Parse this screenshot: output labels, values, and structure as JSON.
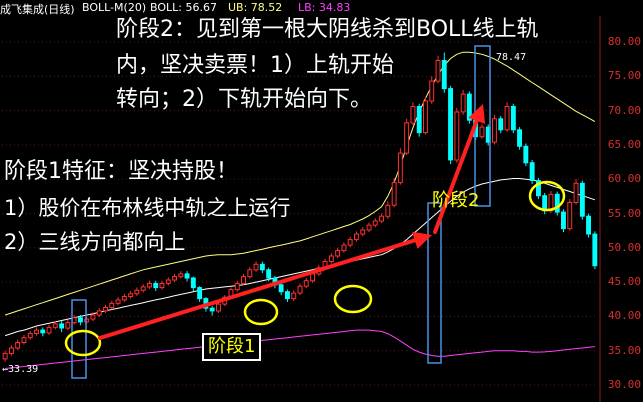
{
  "header": {
    "title": "成飞集成(日线)",
    "indicator": "BOLL-M(20)",
    "boll_label": "BOLL: 56.67",
    "ub_label": "UB: 78.52",
    "lb_label": "LB: 34.83"
  },
  "annotations": {
    "stage2_line1": "阶段2：见到第一根大阴线杀到BOLL线上轨",
    "stage2_line2": "内，坚决卖票！1）上轨开始",
    "stage2_line3": "转向；2）下轨开始向下。",
    "stage1_line1": "阶段1特征：坚决持股！",
    "stage1_line2": "1）股价在布林线中轨之上运行",
    "stage1_line3": "2）三线方向都向上",
    "stage1_box_label": "阶段1",
    "stage2_box_label": "阶段2",
    "low_marker": "33.39",
    "high_marker": "78.47"
  },
  "y_axis": {
    "labels": [
      "80.00",
      "75.00",
      "70.00",
      "65.00",
      "60.00",
      "55.00",
      "50.00",
      "45.00",
      "40.00",
      "35.00",
      "30.00"
    ]
  },
  "colors": {
    "background": "#000000",
    "up_candle": "#ff3030",
    "down_candle": "#00ffff",
    "mid_band": "#ffffff",
    "upper_band": "#ffff80",
    "lower_band": "#ff40ff",
    "arrow": "#ff2020",
    "circle": "#ffff00",
    "box": "#4a90e2"
  },
  "chart_data": {
    "type": "candlestick",
    "title": "成飞集成(日线)",
    "indicator": "BOLL-M(20)",
    "ylim": [
      30,
      82
    ],
    "yticks": [
      80,
      75,
      70,
      65,
      60,
      55,
      50,
      45,
      40,
      35,
      30
    ],
    "y_label_texts": [
      "80.00",
      "75.00",
      "70.00",
      "65.00",
      "60.00",
      "55.00",
      "50.00",
      "45.00",
      "40.00",
      "35.00",
      "30.00"
    ],
    "low_marker": {
      "index": 0,
      "value": 33.39
    },
    "high_marker": {
      "index": 70,
      "value": 78.47
    },
    "candles": [
      {
        "o": 33.8,
        "c": 34.6,
        "h": 35.0,
        "l": 33.4
      },
      {
        "o": 34.6,
        "c": 35.4,
        "h": 35.8,
        "l": 34.3
      },
      {
        "o": 35.4,
        "c": 36.2,
        "h": 36.6,
        "l": 35.1
      },
      {
        "o": 36.2,
        "c": 36.9,
        "h": 37.3,
        "l": 35.9
      },
      {
        "o": 36.9,
        "c": 37.5,
        "h": 37.9,
        "l": 36.6
      },
      {
        "o": 37.5,
        "c": 38.0,
        "h": 38.4,
        "l": 37.2
      },
      {
        "o": 38.0,
        "c": 37.6,
        "h": 38.4,
        "l": 37.1
      },
      {
        "o": 37.6,
        "c": 38.4,
        "h": 38.8,
        "l": 37.3
      },
      {
        "o": 38.4,
        "c": 38.9,
        "h": 39.3,
        "l": 38.1
      },
      {
        "o": 38.9,
        "c": 38.3,
        "h": 39.3,
        "l": 37.7
      },
      {
        "o": 38.3,
        "c": 39.1,
        "h": 39.5,
        "l": 38.0
      },
      {
        "o": 39.1,
        "c": 39.8,
        "h": 40.2,
        "l": 38.8
      },
      {
        "o": 39.8,
        "c": 39.2,
        "h": 40.2,
        "l": 38.7
      },
      {
        "o": 39.2,
        "c": 39.6,
        "h": 40.0,
        "l": 38.9
      },
      {
        "o": 39.6,
        "c": 40.2,
        "h": 40.6,
        "l": 39.3
      },
      {
        "o": 40.2,
        "c": 40.8,
        "h": 41.2,
        "l": 39.9
      },
      {
        "o": 40.8,
        "c": 41.3,
        "h": 41.7,
        "l": 40.5
      },
      {
        "o": 41.3,
        "c": 41.9,
        "h": 42.3,
        "l": 41.0
      },
      {
        "o": 41.9,
        "c": 42.4,
        "h": 42.8,
        "l": 41.6
      },
      {
        "o": 42.4,
        "c": 42.9,
        "h": 43.3,
        "l": 42.1
      },
      {
        "o": 42.9,
        "c": 43.3,
        "h": 43.7,
        "l": 42.6
      },
      {
        "o": 43.3,
        "c": 43.8,
        "h": 44.2,
        "l": 43.0
      },
      {
        "o": 43.8,
        "c": 44.3,
        "h": 44.7,
        "l": 43.5
      },
      {
        "o": 44.3,
        "c": 44.8,
        "h": 45.2,
        "l": 44.0
      },
      {
        "o": 44.8,
        "c": 44.2,
        "h": 45.2,
        "l": 43.7
      },
      {
        "o": 44.2,
        "c": 44.8,
        "h": 45.2,
        "l": 43.9
      },
      {
        "o": 44.8,
        "c": 45.3,
        "h": 45.7,
        "l": 44.5
      },
      {
        "o": 45.3,
        "c": 45.8,
        "h": 46.2,
        "l": 45.0
      },
      {
        "o": 45.8,
        "c": 46.2,
        "h": 46.6,
        "l": 45.5
      },
      {
        "o": 46.2,
        "c": 45.6,
        "h": 46.6,
        "l": 45.1
      },
      {
        "o": 45.6,
        "c": 44.2,
        "h": 45.8,
        "l": 43.7
      },
      {
        "o": 44.2,
        "c": 42.6,
        "h": 44.4,
        "l": 42.1
      },
      {
        "o": 42.6,
        "c": 41.2,
        "h": 42.8,
        "l": 40.7
      },
      {
        "o": 41.2,
        "c": 40.8,
        "h": 41.5,
        "l": 40.1
      },
      {
        "o": 40.8,
        "c": 41.8,
        "h": 42.1,
        "l": 40.5
      },
      {
        "o": 41.8,
        "c": 42.8,
        "h": 43.1,
        "l": 41.5
      },
      {
        "o": 42.8,
        "c": 43.9,
        "h": 44.2,
        "l": 42.5
      },
      {
        "o": 43.9,
        "c": 44.8,
        "h": 45.2,
        "l": 43.6
      },
      {
        "o": 44.8,
        "c": 45.8,
        "h": 46.2,
        "l": 44.5
      },
      {
        "o": 45.8,
        "c": 46.8,
        "h": 47.2,
        "l": 45.5
      },
      {
        "o": 46.8,
        "c": 47.6,
        "h": 48.0,
        "l": 46.5
      },
      {
        "o": 47.6,
        "c": 46.8,
        "h": 48.0,
        "l": 46.3
      },
      {
        "o": 46.8,
        "c": 45.6,
        "h": 47.1,
        "l": 45.1
      },
      {
        "o": 45.6,
        "c": 44.6,
        "h": 45.9,
        "l": 44.1
      },
      {
        "o": 44.6,
        "c": 43.6,
        "h": 44.9,
        "l": 43.1
      },
      {
        "o": 43.6,
        "c": 42.6,
        "h": 43.9,
        "l": 42.1
      },
      {
        "o": 42.6,
        "c": 43.4,
        "h": 43.8,
        "l": 42.2
      },
      {
        "o": 43.4,
        "c": 44.4,
        "h": 44.8,
        "l": 43.1
      },
      {
        "o": 44.4,
        "c": 45.2,
        "h": 45.6,
        "l": 44.1
      },
      {
        "o": 45.2,
        "c": 46.2,
        "h": 46.6,
        "l": 44.9
      },
      {
        "o": 46.2,
        "c": 47.1,
        "h": 47.5,
        "l": 45.9
      },
      {
        "o": 47.1,
        "c": 48.0,
        "h": 48.4,
        "l": 46.8
      },
      {
        "o": 48.0,
        "c": 48.8,
        "h": 49.2,
        "l": 47.7
      },
      {
        "o": 48.8,
        "c": 49.6,
        "h": 50.0,
        "l": 48.5
      },
      {
        "o": 49.6,
        "c": 50.4,
        "h": 50.8,
        "l": 49.3
      },
      {
        "o": 50.4,
        "c": 51.2,
        "h": 51.6,
        "l": 50.1
      },
      {
        "o": 51.2,
        "c": 52.0,
        "h": 52.4,
        "l": 50.9
      },
      {
        "o": 52.0,
        "c": 52.6,
        "h": 53.0,
        "l": 51.7
      },
      {
        "o": 52.6,
        "c": 53.3,
        "h": 53.7,
        "l": 52.3
      },
      {
        "o": 53.3,
        "c": 53.9,
        "h": 54.3,
        "l": 53.0
      },
      {
        "o": 53.9,
        "c": 54.6,
        "h": 55.0,
        "l": 53.6
      },
      {
        "o": 54.6,
        "c": 56.2,
        "h": 56.8,
        "l": 54.2
      },
      {
        "o": 56.2,
        "c": 59.5,
        "h": 60.2,
        "l": 55.9
      },
      {
        "o": 59.5,
        "c": 63.8,
        "h": 64.5,
        "l": 59.2
      },
      {
        "o": 63.8,
        "c": 68.2,
        "h": 68.8,
        "l": 63.5
      },
      {
        "o": 68.2,
        "c": 70.6,
        "h": 71.2,
        "l": 67.9
      },
      {
        "o": 70.6,
        "c": 66.8,
        "h": 71.0,
        "l": 66.2
      },
      {
        "o": 66.8,
        "c": 71.4,
        "h": 72.0,
        "l": 66.5
      },
      {
        "o": 71.4,
        "c": 74.3,
        "h": 75.0,
        "l": 71.0
      },
      {
        "o": 74.3,
        "c": 77.3,
        "h": 78.0,
        "l": 74.0
      },
      {
        "o": 77.3,
        "c": 73.2,
        "h": 78.47,
        "l": 72.6
      },
      {
        "o": 73.2,
        "c": 62.8,
        "h": 73.6,
        "l": 62.2
      },
      {
        "o": 62.8,
        "c": 69.8,
        "h": 70.4,
        "l": 62.4
      },
      {
        "o": 69.8,
        "c": 72.4,
        "h": 73.0,
        "l": 69.4
      },
      {
        "o": 72.4,
        "c": 68.6,
        "h": 72.8,
        "l": 68.1
      },
      {
        "o": 68.6,
        "c": 66.2,
        "h": 69.0,
        "l": 65.7
      },
      {
        "o": 66.2,
        "c": 67.6,
        "h": 68.0,
        "l": 65.9
      },
      {
        "o": 67.6,
        "c": 65.4,
        "h": 68.0,
        "l": 64.9
      },
      {
        "o": 65.4,
        "c": 68.8,
        "h": 69.4,
        "l": 65.1
      },
      {
        "o": 68.8,
        "c": 67.2,
        "h": 69.2,
        "l": 66.7
      },
      {
        "o": 67.2,
        "c": 70.6,
        "h": 71.2,
        "l": 66.9
      },
      {
        "o": 70.6,
        "c": 67.2,
        "h": 71.0,
        "l": 66.7
      },
      {
        "o": 67.2,
        "c": 64.8,
        "h": 67.6,
        "l": 64.3
      },
      {
        "o": 64.8,
        "c": 62.4,
        "h": 65.2,
        "l": 61.9
      },
      {
        "o": 62.4,
        "c": 59.8,
        "h": 62.8,
        "l": 59.3
      },
      {
        "o": 59.8,
        "c": 57.6,
        "h": 60.2,
        "l": 57.1
      },
      {
        "o": 57.6,
        "c": 55.4,
        "h": 58.0,
        "l": 54.9
      },
      {
        "o": 55.4,
        "c": 57.8,
        "h": 58.3,
        "l": 55.1
      },
      {
        "o": 57.8,
        "c": 55.2,
        "h": 58.2,
        "l": 54.7
      },
      {
        "o": 55.2,
        "c": 52.8,
        "h": 55.6,
        "l": 52.3
      },
      {
        "o": 52.8,
        "c": 56.6,
        "h": 57.1,
        "l": 52.5
      },
      {
        "o": 56.6,
        "c": 59.4,
        "h": 60.0,
        "l": 56.3
      },
      {
        "o": 59.4,
        "c": 54.6,
        "h": 59.8,
        "l": 54.1
      },
      {
        "o": 54.6,
        "c": 52.0,
        "h": 55.0,
        "l": 51.5
      },
      {
        "o": 52.0,
        "c": 47.4,
        "h": 52.4,
        "l": 46.9
      }
    ],
    "series": [
      {
        "name": "BOLL",
        "values": [
          37.2,
          37.5,
          37.8,
          38.0,
          38.3,
          38.6,
          38.8,
          39.0,
          39.2,
          39.4,
          39.6,
          39.8,
          40.0,
          40.2,
          40.4,
          40.6,
          40.8,
          41.0,
          41.2,
          41.4,
          41.6,
          41.8,
          42.0,
          42.2,
          42.4,
          42.6,
          42.8,
          43.0,
          43.2,
          43.4,
          43.6,
          43.8,
          44.0,
          44.1,
          44.2,
          44.3,
          44.4,
          44.5,
          44.6,
          44.8,
          45.0,
          45.2,
          45.4,
          45.6,
          45.8,
          46.0,
          46.2,
          46.4,
          46.6,
          46.8,
          47.0,
          47.2,
          47.4,
          47.6,
          47.8,
          48.0,
          48.2,
          48.4,
          48.6,
          48.8,
          49.0,
          49.4,
          49.9,
          50.5,
          51.2,
          52.0,
          52.8,
          53.6,
          54.4,
          55.2,
          56.0,
          56.8,
          57.5,
          58.1,
          58.6,
          59.0,
          59.3,
          59.5,
          59.7,
          59.9,
          60.0,
          60.1,
          60.1,
          60.0,
          59.9,
          59.7,
          59.4,
          59.1,
          58.8,
          58.5,
          58.2,
          57.9,
          57.6,
          57.3,
          57.0
        ]
      },
      {
        "name": "UB",
        "values": [
          40.2,
          40.5,
          40.8,
          41.1,
          41.4,
          41.7,
          42.0,
          42.3,
          42.6,
          42.9,
          43.2,
          43.5,
          43.8,
          44.1,
          44.4,
          44.7,
          45.0,
          45.3,
          45.6,
          45.9,
          46.2,
          46.5,
          46.8,
          47.0,
          47.2,
          47.4,
          47.6,
          47.8,
          48.0,
          48.2,
          48.4,
          48.6,
          48.8,
          48.9,
          49.0,
          49.0,
          49.0,
          49.1,
          49.2,
          49.4,
          49.6,
          49.8,
          50.0,
          50.2,
          50.4,
          50.6,
          50.8,
          51.0,
          51.3,
          51.6,
          51.9,
          52.2,
          52.5,
          52.8,
          53.1,
          53.4,
          53.8,
          54.2,
          54.7,
          55.3,
          56.0,
          57.5,
          59.5,
          62.0,
          64.8,
          67.5,
          69.8,
          71.8,
          73.6,
          75.2,
          76.6,
          77.6,
          78.2,
          78.52,
          78.52,
          78.4,
          78.2,
          77.9,
          77.5,
          77.0,
          76.5,
          75.9,
          75.3,
          74.7,
          74.1,
          73.5,
          72.9,
          72.3,
          71.7,
          71.1,
          70.5,
          69.9,
          69.4,
          68.9,
          68.4
        ]
      },
      {
        "name": "LB",
        "values": [
          32.4,
          32.5,
          32.6,
          32.7,
          32.8,
          32.9,
          33.0,
          33.1,
          33.2,
          33.3,
          33.4,
          33.5,
          33.6,
          33.7,
          33.8,
          33.9,
          34.0,
          34.1,
          34.2,
          34.3,
          34.4,
          34.5,
          34.6,
          34.7,
          34.8,
          34.9,
          35.0,
          35.1,
          35.2,
          35.3,
          35.4,
          35.5,
          35.6,
          35.7,
          35.8,
          35.9,
          36.0,
          36.1,
          36.2,
          36.3,
          36.4,
          36.5,
          36.6,
          36.7,
          36.8,
          36.9,
          37.0,
          37.1,
          37.2,
          37.3,
          37.4,
          37.5,
          37.6,
          37.7,
          37.8,
          37.9,
          38.0,
          38.0,
          38.0,
          37.9,
          37.8,
          37.5,
          37.0,
          36.4,
          35.8,
          35.2,
          34.8,
          34.5,
          34.3,
          34.2,
          34.2,
          34.3,
          34.4,
          34.5,
          34.6,
          34.7,
          34.8,
          34.9,
          35.0,
          35.0,
          35.0,
          35.0,
          34.9,
          34.9,
          34.8,
          34.8,
          34.83,
          34.9,
          35.0,
          35.1,
          35.2,
          35.3,
          35.4,
          35.5,
          35.6
        ]
      }
    ]
  }
}
